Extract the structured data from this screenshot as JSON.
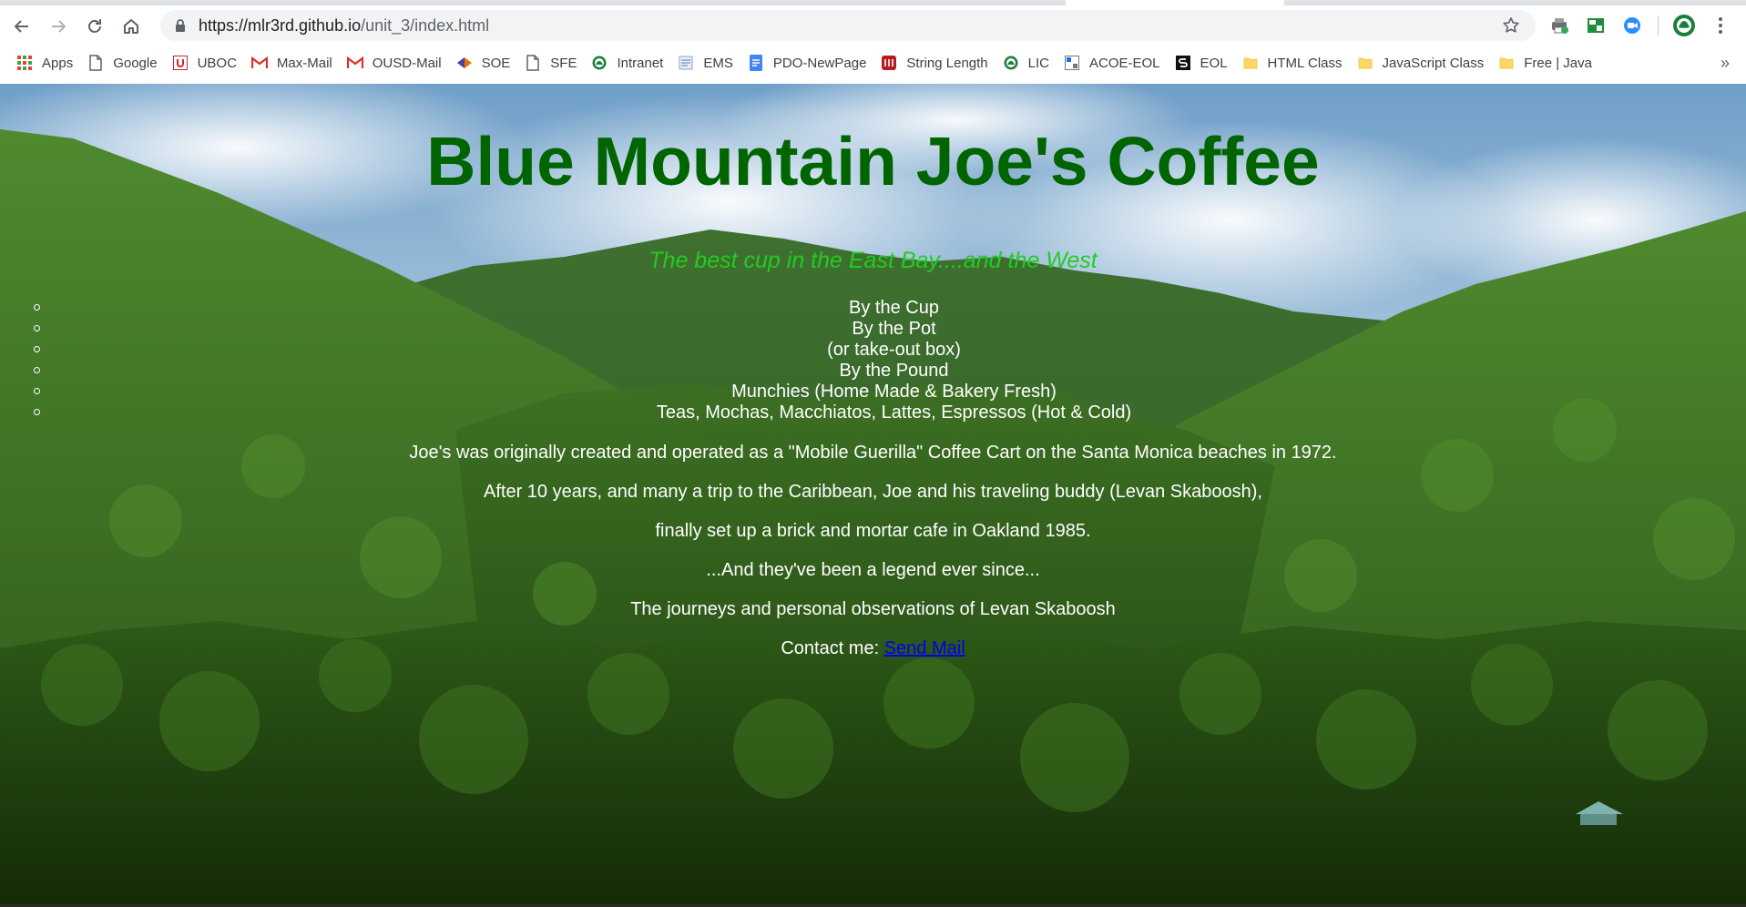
{
  "browser": {
    "url_host": "https://mlr3rd.github.io",
    "url_path": "/unit_3/index.html",
    "bookmarks": [
      {
        "label": "Apps",
        "icon": "apps-grid-icon"
      },
      {
        "label": "Google",
        "icon": "page-icon"
      },
      {
        "label": "UBOC",
        "icon": "uboc-icon"
      },
      {
        "label": "Max-Mail",
        "icon": "gmail-icon"
      },
      {
        "label": "OUSD-Mail",
        "icon": "gmail-icon"
      },
      {
        "label": "SOE",
        "icon": "soe-icon"
      },
      {
        "label": "SFE",
        "icon": "page-icon"
      },
      {
        "label": "Intranet",
        "icon": "intranet-icon"
      },
      {
        "label": "EMS",
        "icon": "ems-icon"
      },
      {
        "label": "PDO-NewPage",
        "icon": "docs-icon"
      },
      {
        "label": "String Length",
        "icon": "string-length-icon"
      },
      {
        "label": "LIC",
        "icon": "intranet-icon"
      },
      {
        "label": "ACOE-EOL",
        "icon": "acoe-icon"
      },
      {
        "label": "EOL",
        "icon": "eol-icon"
      },
      {
        "label": "HTML Class",
        "icon": "folder-icon"
      },
      {
        "label": "JavaScript Class",
        "icon": "folder-icon"
      },
      {
        "label": "Free | Java",
        "icon": "folder-icon"
      }
    ],
    "more_bookmarks": "»"
  },
  "page": {
    "title": "Blue Mountain Joe's Coffee",
    "tagline": "The best cup in the East Bay....and the West",
    "menu": [
      "By the Cup",
      "By the Pot",
      "(or take-out box)",
      "By the Pound",
      "Munchies (Home Made & Bakery Fresh)",
      "Teas, Mochas, Macchiatos, Lattes, Espressos (Hot & Cold)"
    ],
    "story": [
      "Joe's was originally created and operated as a \"Mobile Guerilla\" Coffee Cart on the Santa Monica beaches in 1972.",
      "After 10 years, and many a trip to the Caribbean, Joe and his traveling buddy (Levan Skaboosh),",
      "finally set up a brick and mortar cafe in Oakland 1985.",
      "...And they've been a legend ever since...",
      "The journeys and personal observations of Levan Skaboosh"
    ],
    "contact_label": "Contact me: ",
    "contact_link": "Send Mail"
  },
  "colors": {
    "title": "#006400",
    "tagline": "#22cc22",
    "body_text": "#ffffff",
    "link": "#0000ee"
  }
}
